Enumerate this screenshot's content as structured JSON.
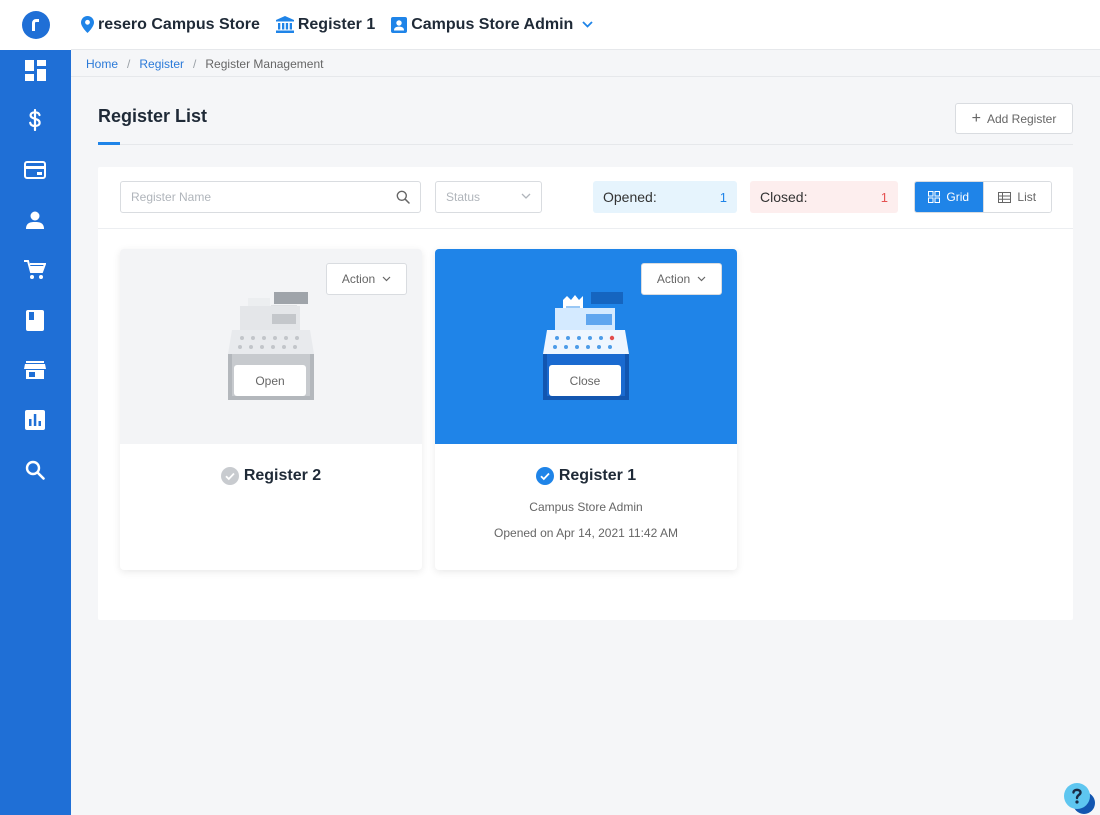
{
  "header": {
    "store": "resero Campus Store",
    "register": "Register 1",
    "user": "Campus Store Admin"
  },
  "sidebar": {
    "items": [
      {
        "icon": "dashboard-icon"
      },
      {
        "icon": "dollar-icon"
      },
      {
        "icon": "card-icon"
      },
      {
        "icon": "user-icon"
      },
      {
        "icon": "cart-icon"
      },
      {
        "icon": "book-icon"
      },
      {
        "icon": "store-icon"
      },
      {
        "icon": "report-icon"
      },
      {
        "icon": "search-icon"
      }
    ]
  },
  "breadcrumb": {
    "home": "Home",
    "register": "Register",
    "current": "Register Management",
    "separator": "/"
  },
  "page": {
    "title": "Register List",
    "add_button": "Add Register",
    "add_icon": "+"
  },
  "toolbar": {
    "search_placeholder": "Register Name",
    "status_placeholder": "Status",
    "opened_label": "Opened:",
    "opened_count": "1",
    "closed_label": "Closed:",
    "closed_count": "1",
    "grid_label": "Grid",
    "list_label": "List",
    "active_view": "Grid"
  },
  "registers": [
    {
      "name": "Register 2",
      "status": "closed",
      "action_label": "Action",
      "toggle_label": "Open"
    },
    {
      "name": "Register 1",
      "status": "opened",
      "action_label": "Action",
      "toggle_label": "Close",
      "opened_by": "Campus Store Admin",
      "opened_on": "Opened on Apr 14, 2021 11:42 AM"
    }
  ],
  "colors": {
    "sidebar": "#1f6fd6",
    "accent": "#1f84e8",
    "opened_bg": "#e6f4fd",
    "closed_bg": "#fdeeee"
  }
}
